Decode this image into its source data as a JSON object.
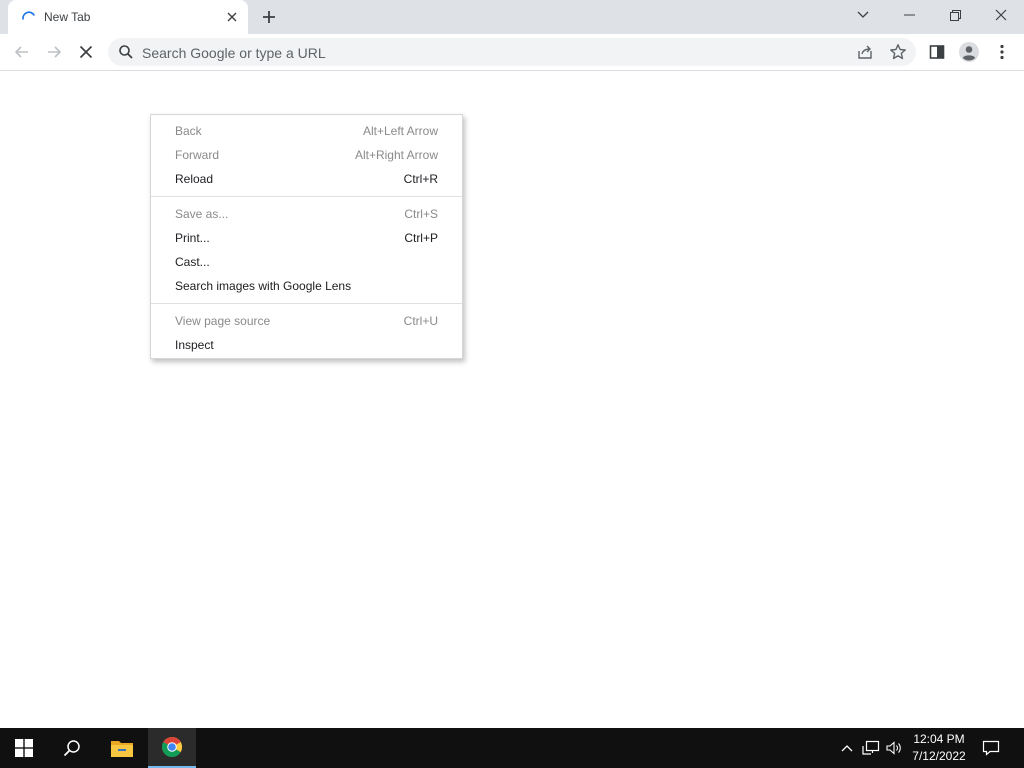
{
  "tab": {
    "title": "New Tab"
  },
  "omnibox": {
    "placeholder": "Search Google or type a URL"
  },
  "context_menu": {
    "groups": [
      [
        {
          "label": "Back",
          "shortcut": "Alt+Left Arrow",
          "enabled": false
        },
        {
          "label": "Forward",
          "shortcut": "Alt+Right Arrow",
          "enabled": false
        },
        {
          "label": "Reload",
          "shortcut": "Ctrl+R",
          "enabled": true
        }
      ],
      [
        {
          "label": "Save as...",
          "shortcut": "Ctrl+S",
          "enabled": false
        },
        {
          "label": "Print...",
          "shortcut": "Ctrl+P",
          "enabled": true
        },
        {
          "label": "Cast...",
          "shortcut": "",
          "enabled": true
        },
        {
          "label": "Search images with Google Lens",
          "shortcut": "",
          "enabled": true
        }
      ],
      [
        {
          "label": "View page source",
          "shortcut": "Ctrl+U",
          "enabled": false
        },
        {
          "label": "Inspect",
          "shortcut": "",
          "enabled": true
        }
      ]
    ]
  },
  "taskbar": {
    "clock_time": "12:04 PM",
    "clock_date": "7/12/2022"
  },
  "colors": {
    "tabstrip_bg": "#dee1e6",
    "omnibox_bg": "#f1f3f4",
    "taskbar_bg": "#101010",
    "taskbar_accent": "#76b9ed"
  },
  "icons": {
    "tab": [
      "loading-spinner-icon",
      "close-icon",
      "plus-icon"
    ],
    "window": [
      "chevron-down-icon",
      "minimize-icon",
      "restore-icon",
      "close-icon"
    ],
    "toolbar": [
      "back-arrow-icon",
      "forward-arrow-icon",
      "stop-icon",
      "search-icon",
      "share-icon",
      "star-icon",
      "side-panel-icon",
      "profile-icon",
      "more-vertical-icon"
    ],
    "taskbar": [
      "windows-logo-icon",
      "search-icon",
      "file-explorer-icon",
      "chrome-icon",
      "chevron-up-icon",
      "network-icon",
      "volume-icon",
      "notification-icon"
    ]
  }
}
